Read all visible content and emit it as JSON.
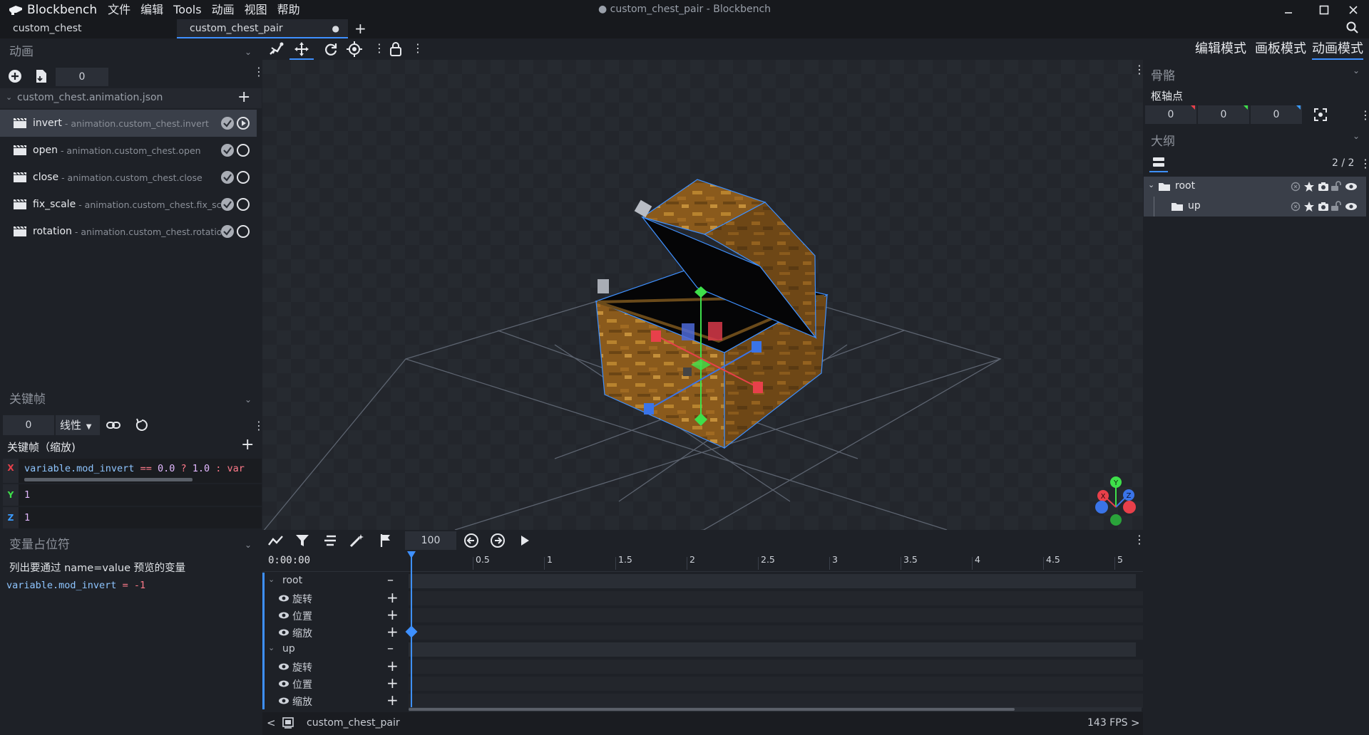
{
  "app": {
    "brand": "Blockbench",
    "window_title": "● custom_chest_pair - Blockbench",
    "menus": [
      "文件",
      "编辑",
      "Tools",
      "动画",
      "视图",
      "帮助"
    ]
  },
  "tabs": [
    "custom_chest",
    "custom_chest_pair"
  ],
  "animation_panel": {
    "title": "动画",
    "time_value": "0",
    "file_name": "custom_chest.animation.json",
    "animations": [
      {
        "name": "invert",
        "id": "- animation.custom_chest.invert",
        "selected": true
      },
      {
        "name": "open",
        "id": "- animation.custom_chest.open",
        "selected": false
      },
      {
        "name": "close",
        "id": "- animation.custom_chest.close",
        "selected": false
      },
      {
        "name": "fix_scale",
        "id": "- animation.custom_chest.fix_sca",
        "selected": false
      },
      {
        "name": "rotation",
        "id": "- animation.custom_chest.rotatior",
        "selected": false
      }
    ]
  },
  "keyframe_panel": {
    "title": "关键帧",
    "time_value": "0",
    "interpolation": "线性",
    "subtitle": "关键帧（缩放)",
    "x_label": "X",
    "y_label": "Y",
    "z_label": "Z",
    "x_expr": {
      "part1": "variable.mod_invert",
      "op": " == ",
      "num1": "0.0",
      "q": " ? ",
      "num2": "1.0",
      "rest": " : var"
    },
    "y_value": "1",
    "z_value": "1"
  },
  "placeholder_panel": {
    "title": "变量占位符",
    "hint": "列出要通过 name=value 预览的变量",
    "var_name": "variable.mod_invert",
    "var_op": " = ",
    "var_value": "-1"
  },
  "timeline": {
    "time_display": "0:00:00",
    "zoom_value": "100",
    "ticks": [
      "0.5",
      "1",
      "1.5",
      "2",
      "2.5",
      "3",
      "3.5",
      "4",
      "4.5",
      "5"
    ],
    "groups": [
      {
        "name": "root",
        "channels": [
          "旋转",
          "位置",
          "缩放"
        ]
      },
      {
        "name": "up",
        "channels": [
          "旋转",
          "位置",
          "缩放"
        ]
      }
    ]
  },
  "statusbar": {
    "model_name": "custom_chest_pair",
    "fps": "143 FPS"
  },
  "right_panel": {
    "modes": [
      "编辑模式",
      "画板模式",
      "动画模式"
    ],
    "active_mode": "动画模式",
    "bone_title": "骨骼",
    "pivot_label": "枢轴点",
    "pivot": [
      "0",
      "0",
      "0"
    ],
    "outline_title": "大纲",
    "outline_count": "2 / 2",
    "outline": [
      {
        "name": "root",
        "indent": 0
      },
      {
        "name": "up",
        "indent": 1
      }
    ]
  },
  "colors": {
    "accent": "#3e90ff",
    "axis_x": "#e8404a",
    "axis_y": "#3ee04a",
    "axis_z": "#3a74e8"
  }
}
